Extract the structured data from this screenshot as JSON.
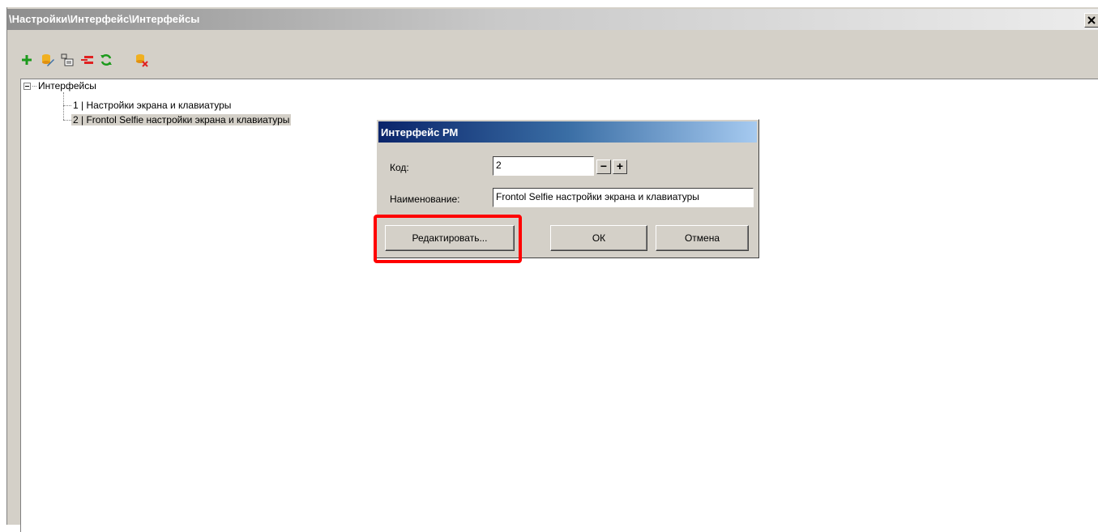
{
  "window": {
    "title": "\\Настройки\\Интерфейс\\Интерфейсы",
    "close_icon": "close-x-icon"
  },
  "toolbar": {
    "items": [
      {
        "name": "add-icon",
        "color": "#1c9a1c"
      },
      {
        "name": "edit-icon",
        "color": "#f0b020"
      },
      {
        "name": "properties-icon",
        "color": "#404040"
      },
      {
        "name": "delete-icon",
        "color": "#e02020"
      },
      {
        "name": "refresh-icon",
        "color": "#1c9a1c"
      },
      {
        "name": "clear-filter-icon",
        "color": "#f0b020"
      }
    ]
  },
  "tree": {
    "root": "Интерфейсы",
    "items": [
      "1 | Настройки экрана и клавиатуры",
      "2 | Frontol Selfie настройки экрана и клавиатуры"
    ]
  },
  "dialog": {
    "title": "Интерфейс РМ",
    "code_label": "Код:",
    "code_value": "2",
    "minus": "−",
    "plus": "+",
    "name_label": "Наименование:",
    "name_value": "Frontol Selfie настройки экрана и клавиатуры",
    "edit_button": "Редактировать...",
    "ok_button": "ОК",
    "cancel_button": "Отмена"
  },
  "colors": {
    "highlight": "#ff0000",
    "dialog_title_start": "#0a246a",
    "dialog_title_end": "#a6caf0"
  }
}
